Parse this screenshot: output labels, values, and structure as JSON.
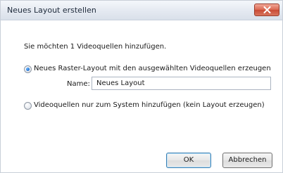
{
  "window": {
    "title": "Neues Layout erstellen",
    "close_icon": "close-x-icon"
  },
  "dialog": {
    "prompt": "Sie möchten 1 Videoquellen hinzufügen.",
    "option_create_layout": {
      "label": "Neues Raster-Layout mit den ausgewählten Videoquellen erzeugen",
      "selected": true
    },
    "name_field": {
      "label": "Name:",
      "value": "Neues Layout"
    },
    "option_system_only": {
      "label": "Videoquellen nur zum System hinzufügen (kein Layout erzeugen)",
      "selected": false
    }
  },
  "buttons": {
    "ok": "OK",
    "cancel": "Abbrechen"
  },
  "colors": {
    "close_button": "#d8604a",
    "radio_selected": "#1f6fd0",
    "default_button_border": "#3c7fb1"
  }
}
